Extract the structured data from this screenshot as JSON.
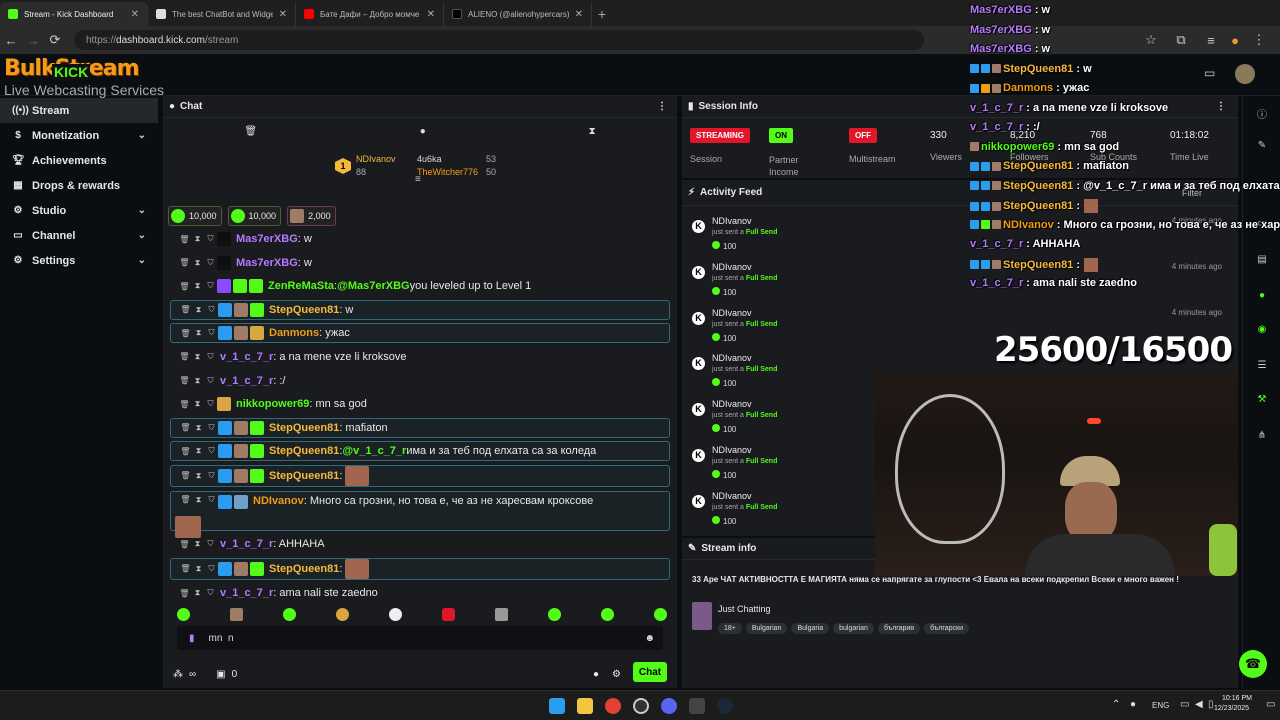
{
  "browser": {
    "tabs": [
      {
        "title": "Stream - Kick Dashboard",
        "active": true,
        "color": "#53fc18"
      },
      {
        "title": "The best ChatBot and Widgets...",
        "active": false,
        "color": "#ffffff"
      },
      {
        "title": "Бате Дафи – Добро момче (Dis...",
        "active": false,
        "color": "#ff0000"
      },
      {
        "title": "ALIENO (@alienohypercars) | Ti...",
        "active": false,
        "color": "#000000"
      }
    ],
    "url_prefix": "https://",
    "url_host": "dashboard.kick.com",
    "url_path": "/stream"
  },
  "logo": {
    "line1": "BulkStream",
    "kick": "KICK",
    "line2": "Live Webcasting Services"
  },
  "sidebar": {
    "items": [
      {
        "label": "Stream",
        "icon": "broadcast-icon"
      },
      {
        "label": "Monetization",
        "icon": "dollar-icon"
      },
      {
        "label": "Achievements",
        "icon": "trophy-icon"
      },
      {
        "label": "Drops & rewards",
        "icon": "gift-icon"
      },
      {
        "label": "Studio",
        "icon": "studio-icon"
      },
      {
        "label": "Channel",
        "icon": "channel-icon"
      },
      {
        "label": "Settings",
        "icon": "gear-icon"
      }
    ]
  },
  "chat": {
    "title": "Chat",
    "leaders": {
      "rank": "1",
      "first_name": "NDIvanov",
      "first_count": "88",
      "second_name": "4u6ka",
      "second_count": "53",
      "third_name": "TheWitcher776",
      "third_count": "50"
    },
    "gift_badges": [
      "10,000",
      "10,000",
      "2,000"
    ],
    "messages": [
      {
        "user": "Mas7erXBG",
        "text": ": w",
        "color": "#b57bff",
        "hl": false
      },
      {
        "user": "Mas7erXBG",
        "text": ": w",
        "color": "#b57bff",
        "hl": false
      },
      {
        "user": "ZenReMaSta",
        "text": ": ",
        "mention": "@Mas7erXBG",
        "rest": " you leveled up to Level 1",
        "color": "#53fc18",
        "hl": false
      },
      {
        "user": "StepQueen81",
        "text": ": w",
        "color": "#f6b93b",
        "hl": true
      },
      {
        "user": "Danmons",
        "text": ": ужас",
        "color": "#f39c12",
        "hl": true
      },
      {
        "user": "v_1_c_7_r",
        "text": ": a na mene vze li kroksove",
        "color": "#b57bff",
        "hl": false
      },
      {
        "user": "v_1_c_7_r",
        "text": ": :/",
        "color": "#b57bff",
        "hl": false
      },
      {
        "user": "nikkopower69",
        "text": ": mn sa god",
        "color": "#53fc18",
        "hl": false
      },
      {
        "user": "StepQueen81",
        "text": ": mafiaton",
        "color": "#f6b93b",
        "hl": true
      },
      {
        "user": "StepQueen81",
        "text": ": ",
        "mention": "@v_1_c_7_r",
        "rest": " има и за теб под елхата са за коледа",
        "color": "#f6b93b",
        "hl": true
      },
      {
        "user": "StepQueen81",
        "text": ":",
        "color": "#f6b93b",
        "hl": true
      },
      {
        "user": "NDIvanov",
        "text": ": Много са грозни, но това е, че аз не харесвам кроксове",
        "color": "#f39c12",
        "hl": true
      },
      {
        "user": "v_1_c_7_r",
        "text": ": AHHAHA",
        "color": "#b57bff",
        "hl": false
      },
      {
        "user": "StepQueen81",
        "text": ":",
        "color": "#f6b93b",
        "hl": true
      },
      {
        "user": "v_1_c_7_r",
        "text": ": ama nali ste zaedno",
        "color": "#b57bff",
        "hl": false
      }
    ],
    "input_value": "mn  n",
    "viewers_icon": "∞",
    "count": "0",
    "send_label": "Chat"
  },
  "session": {
    "title": "Session Info",
    "stats": [
      {
        "tag": "STREAMING",
        "label": "Session",
        "tag_color": "#e0162b"
      },
      {
        "tag": "ON",
        "label": "Partner Income",
        "tag_color": "#53fc18"
      },
      {
        "tag": "OFF",
        "label": "Multistream",
        "tag_color": "#e0162b"
      },
      {
        "value": "330",
        "label": "Viewers"
      },
      {
        "value": "8,210",
        "label": "Followers"
      },
      {
        "value": "768",
        "label": "Sub Counts"
      },
      {
        "value": "01:18:02",
        "label": "Time Live"
      }
    ]
  },
  "activity": {
    "title": "Activity Feed",
    "filter": "Filter",
    "items": [
      {
        "name": "NDIvanov",
        "sent": "just sent a ",
        "kind": "Full Send",
        "value": "100",
        "time": "4 minutes ago"
      },
      {
        "name": "NDIvanov",
        "sent": "just sent a ",
        "kind": "Full Send",
        "value": "100",
        "time": "4 minutes ago"
      },
      {
        "name": "NDIvanov",
        "sent": "just sent a ",
        "kind": "Full Send",
        "value": "100",
        "time": "4 minutes ago"
      },
      {
        "name": "NDIvanov",
        "sent": "just sent a ",
        "kind": "Full Send",
        "value": "100",
        "time": ""
      },
      {
        "name": "NDIvanov",
        "sent": "just sent a ",
        "kind": "Full Send",
        "value": "100",
        "time": ""
      },
      {
        "name": "NDIvanov",
        "sent": "just sent a ",
        "kind": "Full Send",
        "value": "100",
        "time": ""
      },
      {
        "name": "NDIvanov",
        "sent": "just sent a ",
        "kind": "Full Send",
        "value": "100",
        "time": ""
      }
    ]
  },
  "streaminfo": {
    "title": "Stream info",
    "description": "33 Аре ЧАТ АКТИВНОСТТА Е МАГИЯТА няма се напрягате за глупости <3 Евала на всеки подкрепил Всеки е много важен !",
    "category": "Just Chatting",
    "tags": [
      "18+",
      "Bulgarian",
      "Bulgaria",
      "bulgarian",
      "българия",
      "български"
    ]
  },
  "overlay": {
    "lines": [
      {
        "user": "Mas7erXBG",
        "text": " : w",
        "color": "#b57bff"
      },
      {
        "user": "Mas7erXBG",
        "text": " : w",
        "color": "#b57bff"
      },
      {
        "user": "Mas7erXBG",
        "text": " : w",
        "color": "#b57bff"
      },
      {
        "user": "StepQueen81",
        "text": " : w",
        "color": "#f6b93b"
      },
      {
        "user": "Danmons",
        "text": " : ужас",
        "color": "#f39c12"
      },
      {
        "user": "v_1_c_7_r",
        "text": " : a na mene vze li kroksove",
        "color": "#b57bff"
      },
      {
        "user": "v_1_c_7_r",
        "text": " : :/",
        "color": "#b57bff"
      },
      {
        "user": "nikkopower69",
        "text": " : mn sa god",
        "color": "#53fc18"
      },
      {
        "user": "StepQueen81",
        "text": " : mafiaton",
        "color": "#f6b93b"
      },
      {
        "user": "StepQueen81",
        "text": " : @v_1_c_7_r има и за теб под елхата са з",
        "color": "#f6b93b"
      },
      {
        "user": "StepQueen81",
        "text": " :",
        "color": "#f6b93b"
      },
      {
        "user": "NDIvanov",
        "text": " : Много са грозни, но това е, че аз не харесв",
        "color": "#f39c12"
      },
      {
        "user": "v_1_c_7_r",
        "text": " : AHHAHA",
        "color": "#b57bff"
      },
      {
        "user": "StepQueen81",
        "text": " :",
        "color": "#f6b93b"
      },
      {
        "user": "v_1_c_7_r",
        "text": " : ama nali ste zaedno",
        "color": "#b57bff"
      }
    ],
    "counter": "25600/16500"
  },
  "taskbar": {
    "lang": "ENG",
    "time": "10:16 PM",
    "date": "12/23/2025"
  }
}
